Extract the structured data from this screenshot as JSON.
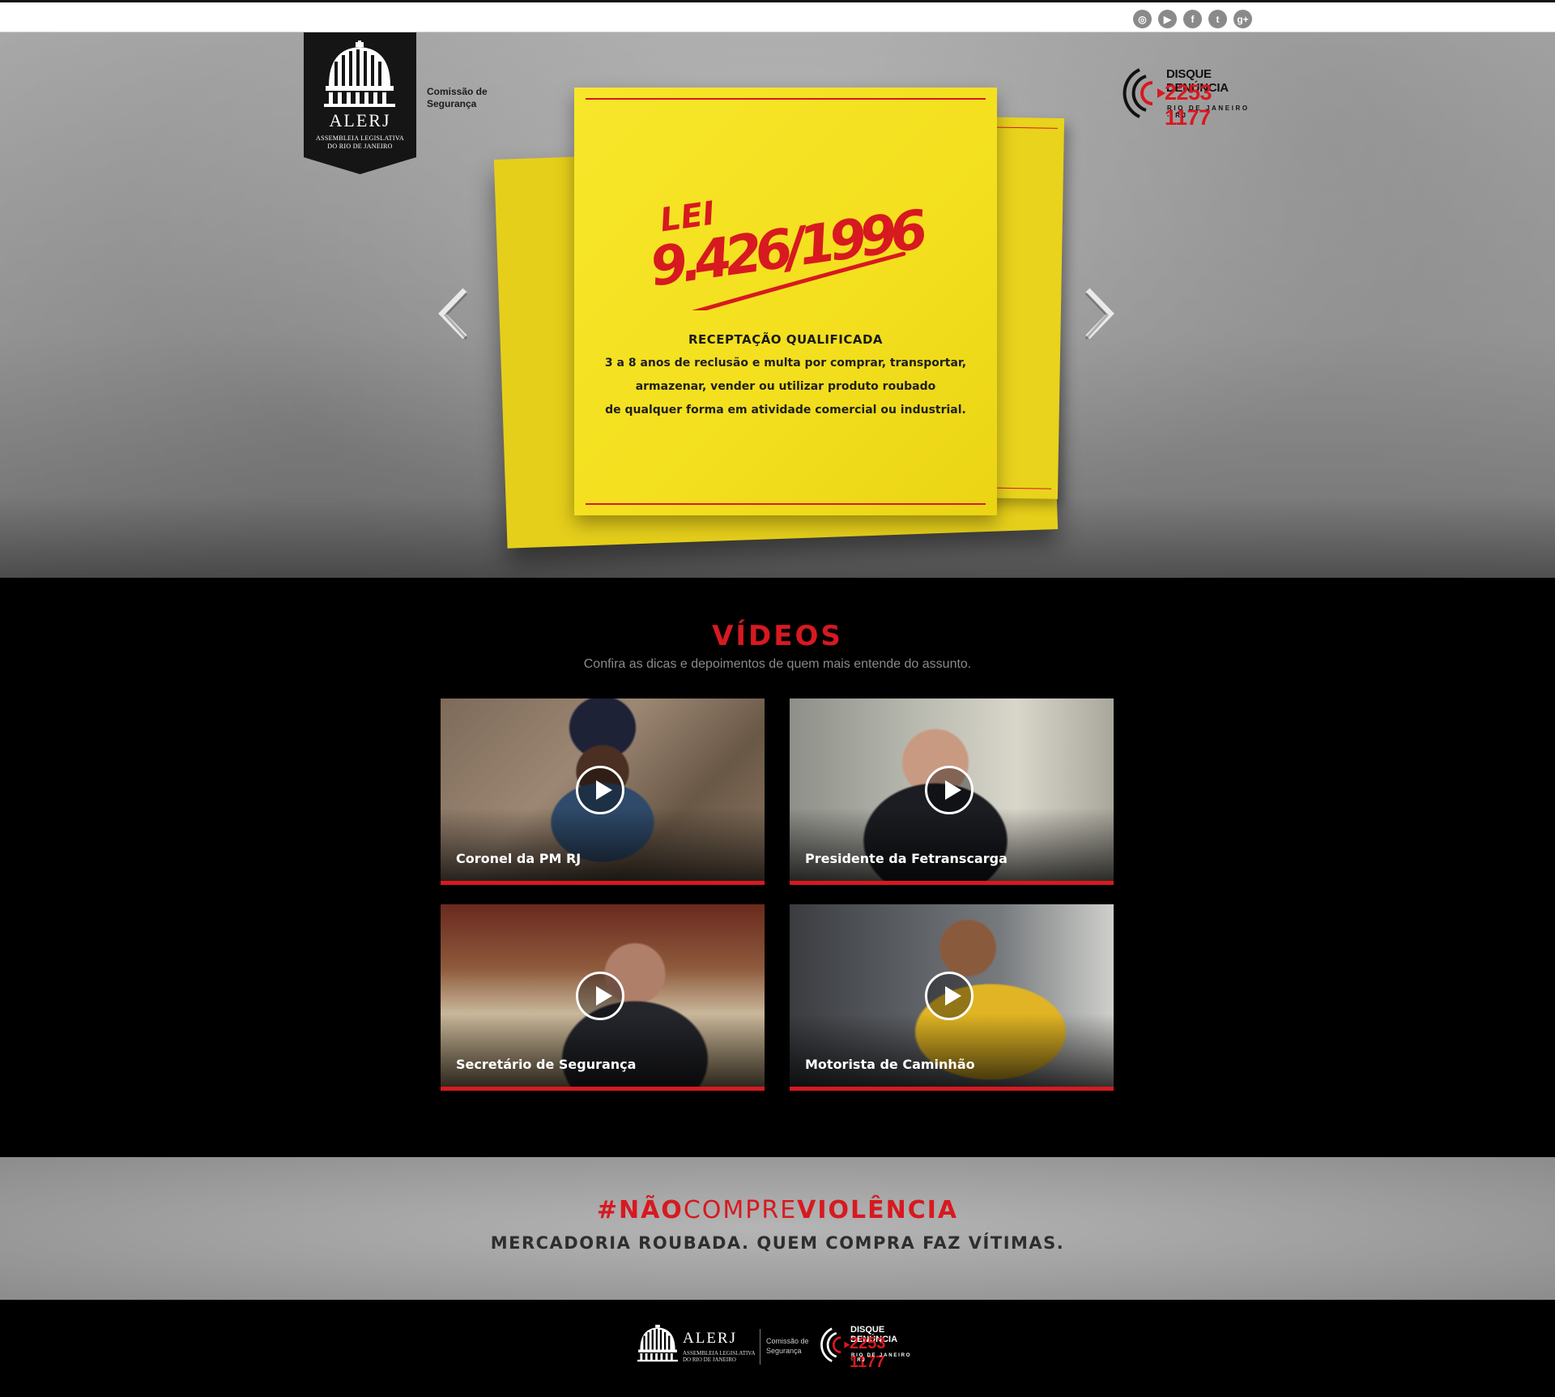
{
  "topbar": {
    "social": [
      {
        "icon": "instagram-icon",
        "glyph": "◎"
      },
      {
        "icon": "youtube-icon",
        "glyph": "▶"
      },
      {
        "icon": "facebook-icon",
        "glyph": "f"
      },
      {
        "icon": "twitter-icon",
        "glyph": "t"
      },
      {
        "icon": "google-plus-icon",
        "glyph": "g+"
      }
    ]
  },
  "header": {
    "logo_name": "ALERJ",
    "logo_sub_line1": "ASSEMBLEIA LEGISLATIVA",
    "logo_sub_line2": "DO RIO DE JANEIRO",
    "comissao_line1": "Comissão de",
    "comissao_line2": "Segurança",
    "disque_label": "DISQUE DENÚNCIA",
    "disque_phone": "2253 1177",
    "disque_city": "RIO DE JANEIRO - RJ"
  },
  "slide": {
    "law_prefix": "LEI",
    "law_number": "9.426/1996",
    "title": "RECEPTAÇÃO QUALIFICADA",
    "line1": "3 a 8 anos de reclusão e multa por comprar, transportar,",
    "line2": "armazenar, vender ou utilizar produto roubado",
    "line3": "de qualquer forma em atividade comercial ou industrial."
  },
  "videos": {
    "title": "VÍDEOS",
    "subtitle": "Confira as dicas e depoimentos de quem mais entende do assunto.",
    "items": [
      {
        "caption": "Coronel da PM RJ"
      },
      {
        "caption": "Presidente da Fetranscarga"
      },
      {
        "caption": "Secretário de Segurança"
      },
      {
        "caption": "Motorista de Caminhão"
      }
    ]
  },
  "campaign": {
    "hashtag_hash": "#",
    "hashtag_w1": "NÃO",
    "hashtag_w2": "COMPRE",
    "hashtag_w3": "VIOLÊNCIA",
    "slogan": "MERCADORIA ROUBADA. QUEM COMPRA FAZ VÍTIMAS."
  },
  "footer": {
    "logo_name": "ALERJ",
    "logo_sub_line1": "ASSEMBLEIA LEGISLATIVA",
    "logo_sub_line2": "DO RIO DE JANEIRO",
    "comissao_line1": "Comissão de",
    "comissao_line2": "Segurança",
    "disque_label": "DISQUE DENÚNCIA",
    "disque_phone": "2253 1177",
    "disque_city": "RIO DE JANEIRO - RJ"
  },
  "colors": {
    "accent_red": "#d71920",
    "note_yellow": "#f3df1d"
  }
}
